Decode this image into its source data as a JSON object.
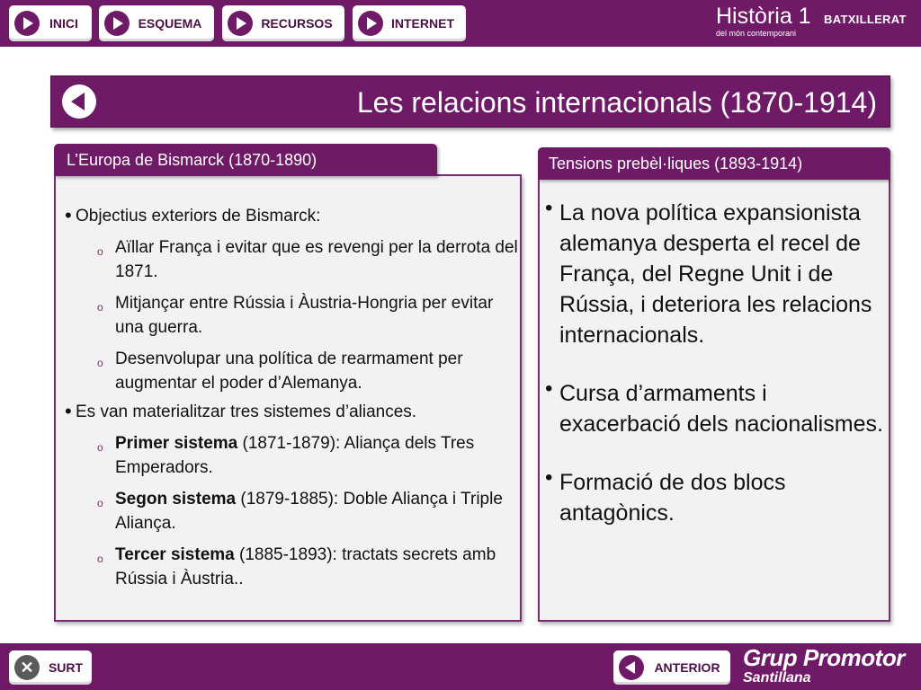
{
  "nav": {
    "items": [
      {
        "label": "INICI"
      },
      {
        "label": "ESQUEMA"
      },
      {
        "label": "RECURSOS"
      },
      {
        "label": "INTERNET"
      }
    ]
  },
  "brand": {
    "title": "Història 1",
    "level": "BATXILLERAT",
    "subtitle": "del món contemporani"
  },
  "slide": {
    "title": "Les relacions internacionals (1870-1914)"
  },
  "left_panel": {
    "heading": "L’Europa de Bismarck (1870-1890)",
    "bullets": [
      {
        "text": "Objectius exteriors de Bismarck:",
        "subitems": [
          {
            "bold": "",
            "text": "Aïllar França i evitar que es revengi per la derrota del 1871."
          },
          {
            "bold": "",
            "text": "Mitjançar entre Rússia i Àustria-Hongria per evitar una guerra."
          },
          {
            "bold": "",
            "text": "Desenvolupar una política de rearmament per augmentar el poder d’Alemanya."
          }
        ]
      },
      {
        "text": "Es van materialitzar tres sistemes d’aliances.",
        "subitems": [
          {
            "bold": "Primer sistema",
            "text": " (1871-1879): Aliança dels Tres Emperadors."
          },
          {
            "bold": "Segon sistema",
            "text": " (1879-1885):  Doble Aliança i Triple Aliança."
          },
          {
            "bold": "Tercer sistema",
            "text": " (1885-1893): tractats secrets amb Rússia i Àustria.."
          }
        ]
      }
    ]
  },
  "right_panel": {
    "heading": "Tensions prebèl·liques  (1893-1914)",
    "bullets": [
      "La nova política expansionista alemanya desperta el recel de França, del Regne Unit i de Rússia, i deteriora les relacions internacionals.",
      "Cursa d’armaments i exacerbació dels nacionalismes.",
      "Formació de dos blocs antagònics."
    ]
  },
  "footer": {
    "exit_label": "SURT",
    "prev_label": "ANTERIOR",
    "publisher_main": "Grup Promotor",
    "publisher_sub": "Santillana"
  },
  "colors": {
    "brand_purple": "#6e1a66",
    "panel_background": "#f2f2f2"
  }
}
